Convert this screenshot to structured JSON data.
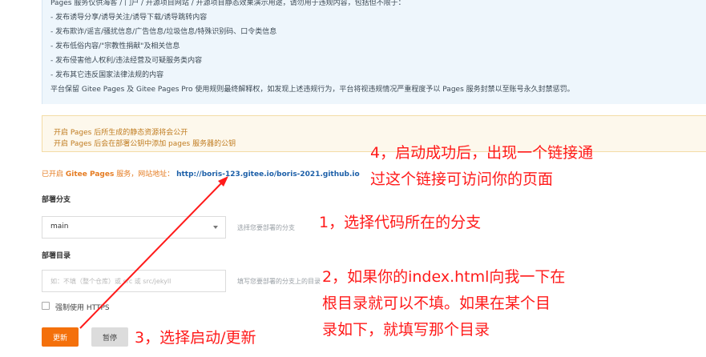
{
  "notice": {
    "lines": [
      "Pages 服务仅供海客 / 门户 / 开源项目网站 / 开源项目静态效果演示用途，请勿用于违规内容，包括但不限于：",
      "- 发布诱导分享/诱导关注/诱导下载/诱导跳转内容",
      "- 发布欺诈/谣言/骚扰信息/广告信息/垃圾信息/特殊识别码、口令类信息",
      "- 发布低俗内容/\"宗教性捐献\"及相关信息",
      "- 发布侵害他人权利/违法经营及可疑服务类内容",
      "- 发布其它违反国家法律法规的内容",
      "平台保留 Gitee Pages 及 Gitee Pages Pro 使用规则最终解释权，如发现上述违规行为，平台将视违规情况严重程度予以 Pages 服务封禁以至账号永久封禁惩罚。"
    ]
  },
  "warning": {
    "line1": "开启 Pages 后所生成的静态资源将会公开",
    "line2": "开启 Pages 后会在部署公钥中添加 pages 服务器的公钥"
  },
  "enabled": {
    "prefix": "已开启 ",
    "service": "Gitee Pages",
    "suffix": " 服务，网站地址：",
    "url": "http://boris-123.gitee.io/boris-2021.github.io"
  },
  "branch": {
    "label": "部署分支",
    "value": "main",
    "hint": "选择您要部署的分支"
  },
  "directory": {
    "label": "部署目录",
    "placeholder": "如：不填（整个仓库）或 src 或 src/jekyll",
    "hint": "填写您要部署的分支上的目录"
  },
  "https": {
    "label": "强制使用 HTTPS"
  },
  "buttons": {
    "update": "更新",
    "pause": "暂停"
  },
  "annotations": {
    "a4_line1": "4，启动成功后，出现一个链接通",
    "a4_line2": "过这个链接可访问你的页面",
    "a1": "1，选择代码所在的分支",
    "a2_line1": "2，如果你的index.html向我一下在",
    "a2_line2": "根目录就可以不填。如果在某个目",
    "a2_line3": "录如下，就填写那个目录",
    "a3": "3，选择启动/更新"
  },
  "colors": {
    "accent": "#f4700b",
    "annotation": "#ff1a1a",
    "link": "#1c5fa8",
    "warning_text": "#c07b1f"
  }
}
